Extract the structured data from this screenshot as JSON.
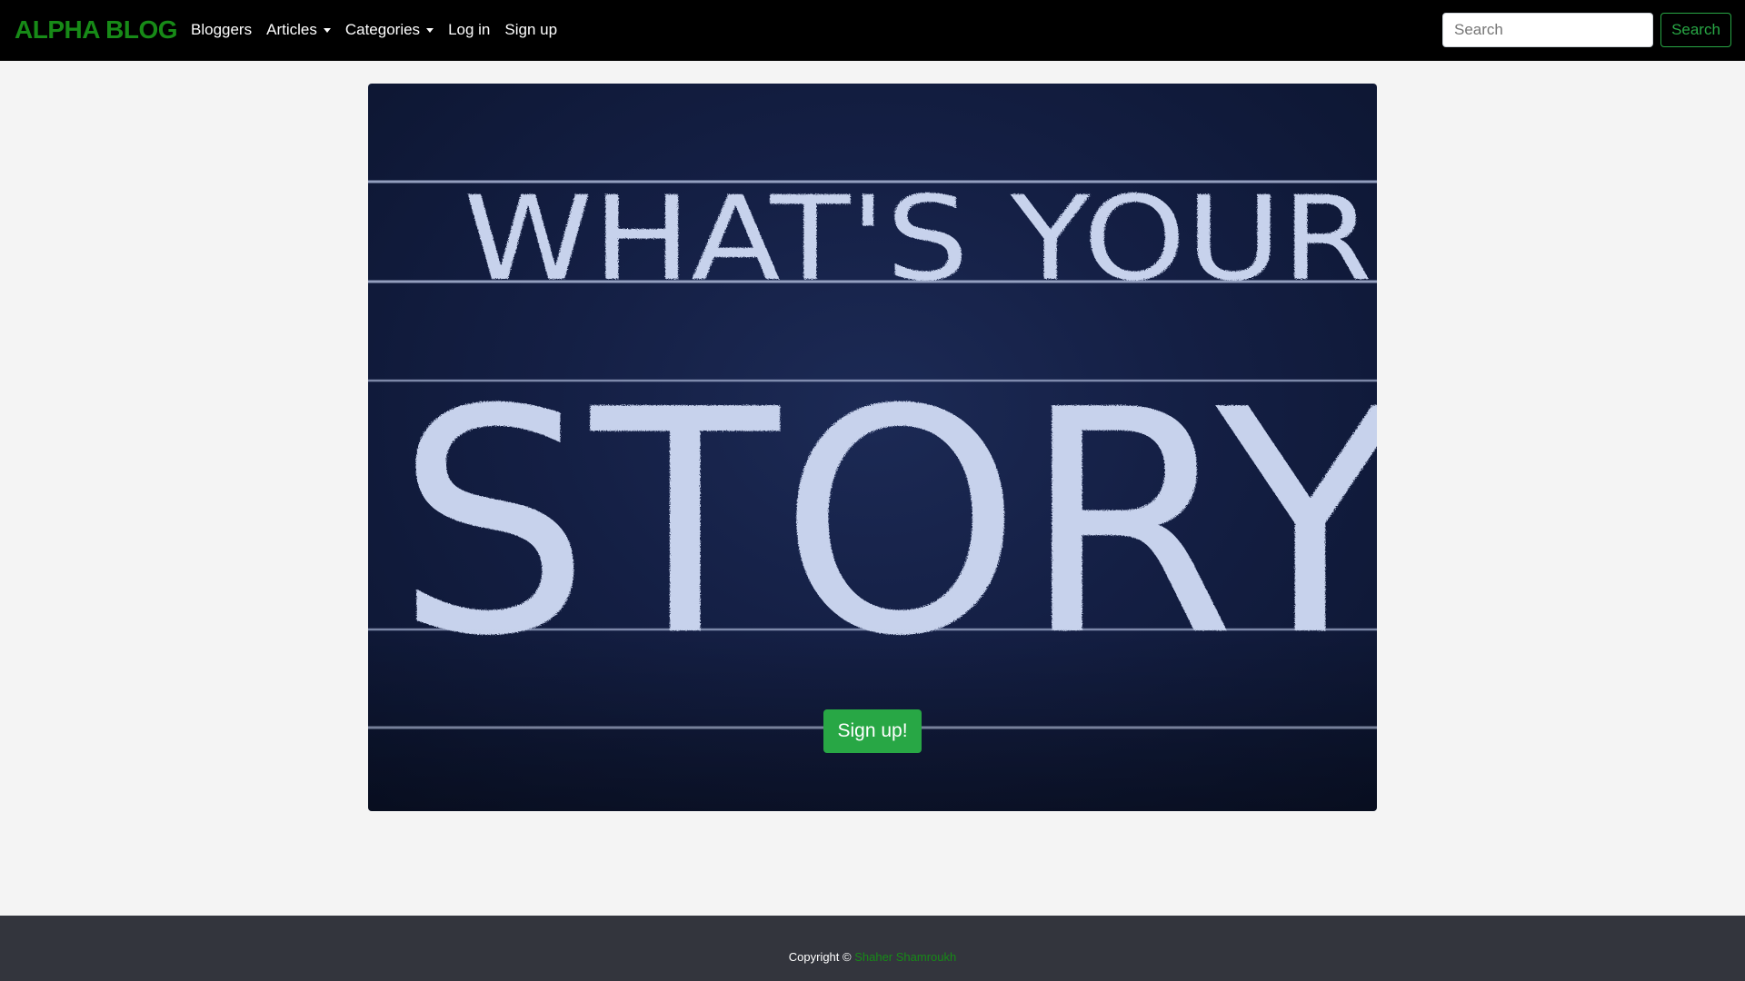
{
  "navbar": {
    "brand": "ALPHA BLOG",
    "links": [
      {
        "label": "Bloggers"
      },
      {
        "label": "Articles"
      },
      {
        "label": "Categories"
      },
      {
        "label": "Log in"
      },
      {
        "label": "Sign up"
      }
    ],
    "search_placeholder": "Search",
    "search_button": "Search",
    "colors": {
      "background": "#000000",
      "brand": "#178a17",
      "success": "#28a745"
    }
  },
  "hero": {
    "image_text_line1": "WHAT'S YOUR",
    "image_text_line2": "STORY",
    "signup_button": "Sign up!"
  },
  "footer": {
    "copyright_prefix": "Copyright ©",
    "author": "Shaher Shamroukh"
  }
}
